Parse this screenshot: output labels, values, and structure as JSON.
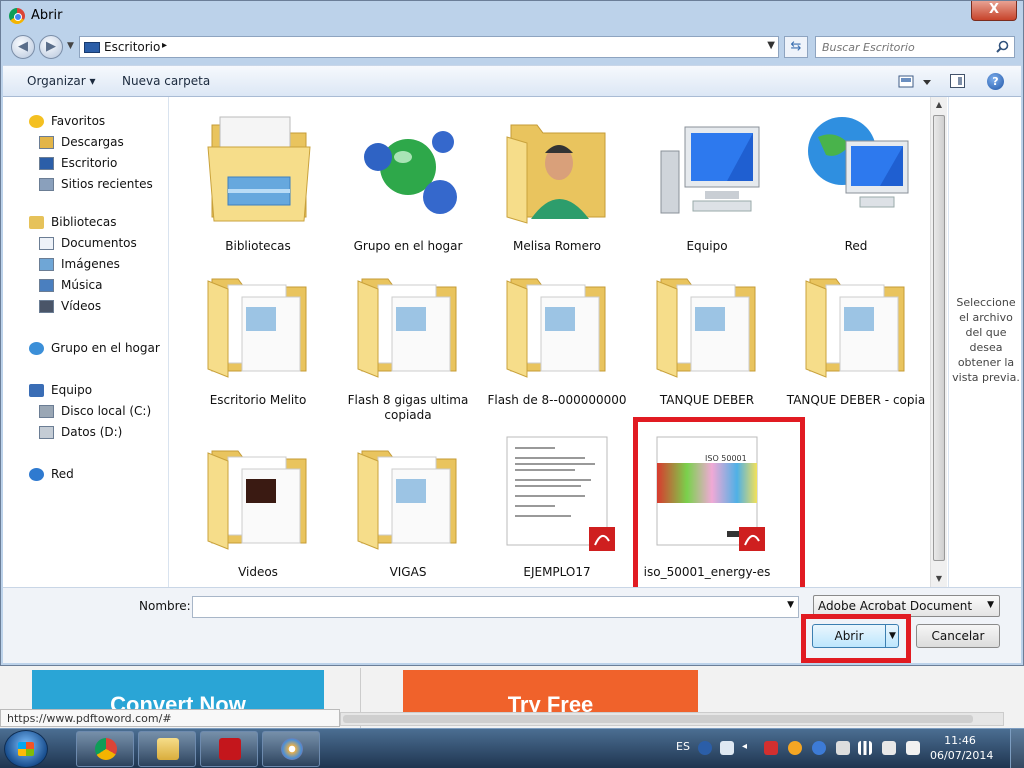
{
  "dialog": {
    "title": "Abrir",
    "close_label": "X",
    "address": {
      "location": "Escritorio",
      "separator": "▸"
    },
    "search": {
      "placeholder": "Buscar Escritorio"
    },
    "toolbar": {
      "organize_label": "Organizar ▾",
      "new_folder_label": "Nueva carpeta",
      "help_label": "?"
    },
    "nav": {
      "groups": [
        {
          "label": "Favoritos",
          "icon": "star-icon",
          "items": [
            {
              "label": "Descargas",
              "icon": "downloads-icon"
            },
            {
              "label": "Escritorio",
              "icon": "desktop-icon"
            },
            {
              "label": "Sitios recientes",
              "icon": "recent-places-icon"
            }
          ]
        },
        {
          "label": "Bibliotecas",
          "icon": "libraries-icon",
          "items": [
            {
              "label": "Documentos",
              "icon": "documents-icon"
            },
            {
              "label": "Imágenes",
              "icon": "pictures-icon"
            },
            {
              "label": "Música",
              "icon": "music-icon"
            },
            {
              "label": "Vídeos",
              "icon": "videos-icon"
            }
          ]
        },
        {
          "label": "Grupo en el hogar",
          "icon": "homegroup-icon",
          "items": []
        },
        {
          "label": "Equipo",
          "icon": "computer-icon",
          "items": [
            {
              "label": "Disco local (C:)",
              "icon": "drive-c-icon"
            },
            {
              "label": "Datos (D:)",
              "icon": "drive-d-icon"
            }
          ]
        },
        {
          "label": "Red",
          "icon": "network-icon",
          "items": []
        }
      ]
    },
    "files": [
      {
        "name": "Bibliotecas",
        "icon": "libraries-folder-icon"
      },
      {
        "name": "Grupo en el hogar",
        "icon": "homegroup-icon"
      },
      {
        "name": "Melisa Romero",
        "icon": "user-folder-icon"
      },
      {
        "name": "Equipo",
        "icon": "computer-icon"
      },
      {
        "name": "Red",
        "icon": "network-icon"
      },
      {
        "name": "Escritorio Melito",
        "icon": "folder-icon"
      },
      {
        "name": "Flash 8 gigas ultima copiada",
        "icon": "folder-icon"
      },
      {
        "name": "Flash de 8--000000000",
        "icon": "folder-icon"
      },
      {
        "name": "TANQUE DEBER",
        "icon": "folder-icon"
      },
      {
        "name": "TANQUE DEBER - copia",
        "icon": "folder-icon"
      },
      {
        "name": "Videos",
        "icon": "folder-icon"
      },
      {
        "name": "VIGAS",
        "icon": "folder-icon"
      },
      {
        "name": "EJEMPLO17",
        "icon": "pdf-file-icon"
      },
      {
        "name": "iso_50001_energy-es",
        "icon": "pdf-file-icon",
        "selected_highlight": true
      }
    ],
    "iso_cover_text": "ISO 50001",
    "preview_message": "Seleccione el archivo del que desea obtener la vista previa.",
    "filename": {
      "label": "Nombre:",
      "value": ""
    },
    "filetype": {
      "selected": "Adobe Acrobat Document"
    },
    "buttons": {
      "open": "Abrir",
      "cancel": "Cancelar"
    }
  },
  "background_page": {
    "convert_button": "Convert Now",
    "try_button": "Try Free",
    "status_url": "https://www.pdftoword.com/#"
  },
  "taskbar": {
    "apps": [
      {
        "name": "chrome",
        "icon": "chrome-icon"
      },
      {
        "name": "explorer",
        "icon": "file-explorer-icon"
      },
      {
        "name": "acrobat",
        "icon": "acrobat-icon"
      },
      {
        "name": "paint",
        "icon": "paint-icon"
      }
    ],
    "language": "ES",
    "time": "11:46",
    "date": "06/07/2014"
  },
  "colors": {
    "highlight_red": "#e11b22",
    "folder_yellow": "#f3d675",
    "window_blue": "#bcd2ea"
  }
}
